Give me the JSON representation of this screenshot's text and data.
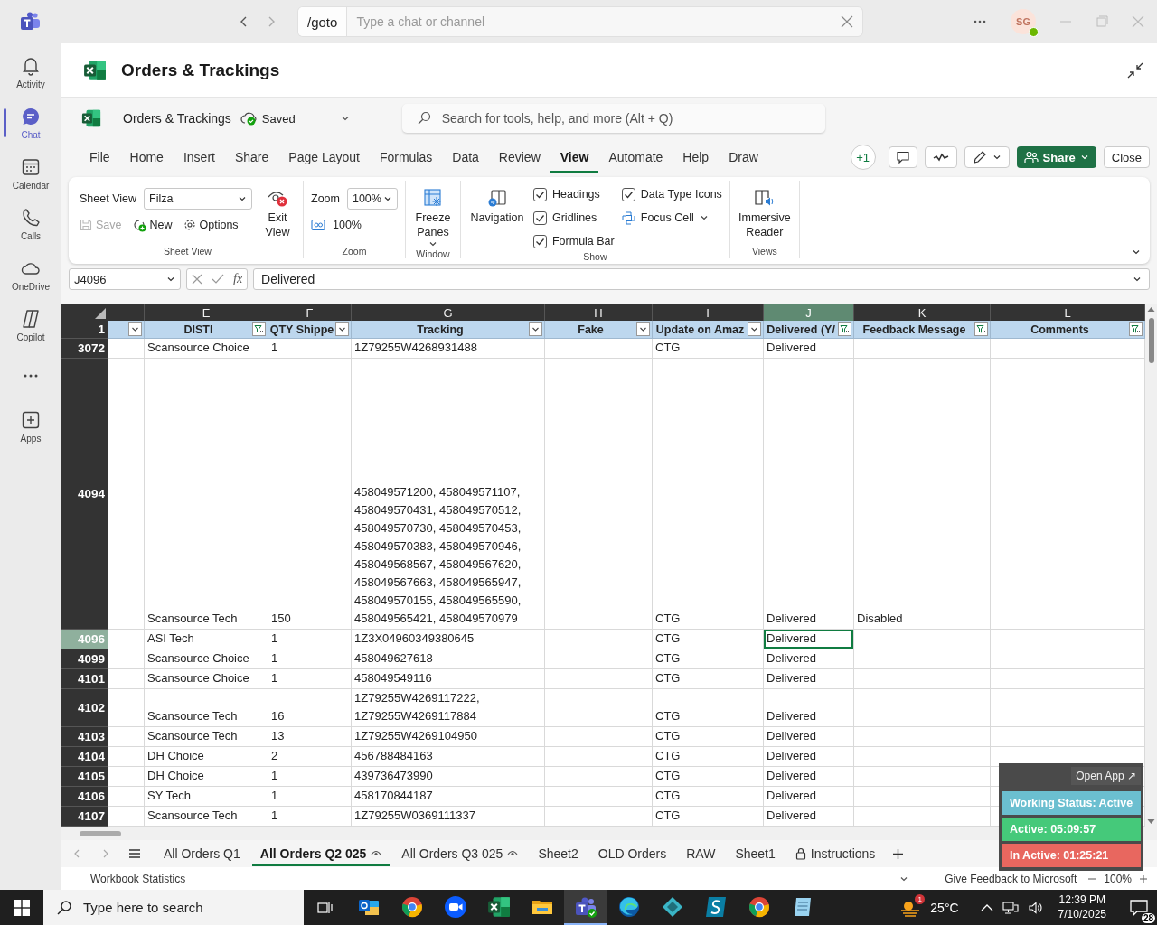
{
  "teams_bar": {
    "command": "/goto",
    "search_placeholder": "Type a chat or channel",
    "avatar_initials": "SG"
  },
  "rail": [
    {
      "kind": "bell",
      "label": "Activity",
      "selected": false
    },
    {
      "kind": "chat",
      "label": "Chat",
      "selected": true
    },
    {
      "kind": "calendar",
      "label": "Calendar",
      "selected": false
    },
    {
      "kind": "phone",
      "label": "Calls",
      "selected": false
    },
    {
      "kind": "cloud",
      "label": "OneDrive",
      "selected": false
    },
    {
      "kind": "copilot",
      "label": "Copilot",
      "selected": false
    },
    {
      "kind": "more",
      "selected": false
    },
    {
      "kind": "apps",
      "label": "Apps",
      "selected": false
    }
  ],
  "app_header": {
    "title": "Orders & Trackings"
  },
  "excel": {
    "file_name": "Orders & Trackings",
    "save_status": "Saved",
    "search_placeholder": "Search for tools, help, and more (Alt + Q)"
  },
  "menu_tabs": [
    {
      "label": "File",
      "selected": false
    },
    {
      "label": "Home",
      "selected": false
    },
    {
      "label": "Insert",
      "selected": false
    },
    {
      "label": "Share",
      "selected": false
    },
    {
      "label": "Page Layout",
      "selected": false
    },
    {
      "label": "Formulas",
      "selected": false
    },
    {
      "label": "Data",
      "selected": false
    },
    {
      "label": "Review",
      "selected": false
    },
    {
      "label": "View",
      "selected": true
    },
    {
      "label": "Automate",
      "selected": false
    },
    {
      "label": "Help",
      "selected": false
    },
    {
      "label": "Draw",
      "selected": false
    }
  ],
  "toolbar": {
    "coauthors": "+1",
    "share": "Share",
    "close": "Close"
  },
  "ribbon": {
    "sheet_view": {
      "label": "Sheet View",
      "select_label": "Sheet View",
      "select_value": "Filza",
      "save": "Save",
      "save_disabled": true,
      "new": "New",
      "options": "Options",
      "exit": "Exit View"
    },
    "zoom": {
      "label": "Zoom",
      "select_label": "Zoom",
      "select_value": "100%",
      "reset": "100%"
    },
    "window": {
      "label": "Window",
      "freeze": "Freeze Panes"
    },
    "show": {
      "label": "Show",
      "navigation": "Navigation",
      "checks": [
        {
          "label": "Headings",
          "checked": true
        },
        {
          "label": "Gridlines",
          "checked": true
        },
        {
          "label": "Formula Bar",
          "checked": true
        },
        {
          "label": "Data Type Icons",
          "checked": true
        }
      ],
      "focus_cell": "Focus Cell"
    },
    "views": {
      "label": "Views",
      "immersive": "Immersive Reader"
    }
  },
  "formula_bar": {
    "name_box": "J4096",
    "function_button": "fx",
    "formula": "Delivered"
  },
  "sheet": {
    "columns": [
      {
        "filtered": false,
        "selected": false
      },
      {
        "letter": "E",
        "title": "DISTI",
        "filtered": true,
        "selected": false
      },
      {
        "letter": "F",
        "title": "QTY Shippe",
        "filtered": false,
        "selected": false
      },
      {
        "letter": "G",
        "title": "Tracking",
        "filtered": false,
        "selected": false
      },
      {
        "letter": "H",
        "title": "Fake",
        "filtered": false,
        "selected": false
      },
      {
        "letter": "I",
        "title": "Update on Amaz",
        "filtered": false,
        "selected": false
      },
      {
        "letter": "J",
        "title": "Delivered (Y/",
        "filtered": true,
        "selected": true
      },
      {
        "letter": "K",
        "title": "Feedback Message",
        "filtered": true,
        "selected": false
      },
      {
        "letter": "L",
        "title": "Comments",
        "filtered": true,
        "selected": false
      }
    ],
    "header_row": "1",
    "rows": [
      {
        "number": "3072",
        "selected": false,
        "disti": "Scansource Choice",
        "qty_shipped": "1",
        "tracking": "1Z79255W4268931488",
        "update_on_amazon": "CTG",
        "delivered": "Delivered"
      },
      {
        "number": "4094",
        "selected": false,
        "disti": "Scansource Tech",
        "qty_shipped": "150",
        "tracking": "458049571200, 458049571107, 458049570431, 458049570512, 458049570730, 458049570453, 458049570383, 458049570946, 458049568567, 458049567620, 458049567663, 458049565947, 458049570155, 458049565590, 458049565421, 458049570979",
        "update_on_amazon": "CTG",
        "delivered": "Delivered",
        "feedback_message": "Disabled"
      },
      {
        "number": "4096",
        "selected": true,
        "disti": "ASI Tech",
        "qty_shipped": "1",
        "tracking": "1Z3X04960349380645",
        "update_on_amazon": "CTG",
        "delivered": "Delivered"
      },
      {
        "number": "4099",
        "selected": false,
        "disti": "Scansource Choice",
        "qty_shipped": "1",
        "tracking": "458049627618",
        "update_on_amazon": "CTG",
        "delivered": "Delivered"
      },
      {
        "number": "4101",
        "selected": false,
        "disti": "Scansource Choice",
        "qty_shipped": "1",
        "tracking": "458049549116",
        "update_on_amazon": "CTG",
        "delivered": "Delivered"
      },
      {
        "number": "4102",
        "selected": false,
        "disti": "Scansource Tech",
        "qty_shipped": "16",
        "tracking": "1Z79255W4269117222, 1Z79255W4269117884",
        "update_on_amazon": "CTG",
        "delivered": "Delivered"
      },
      {
        "number": "4103",
        "selected": false,
        "disti": "Scansource Tech",
        "qty_shipped": "13",
        "tracking": "1Z79255W4269104950",
        "update_on_amazon": "CTG",
        "delivered": "Delivered"
      },
      {
        "number": "4104",
        "selected": false,
        "disti": "DH Choice",
        "qty_shipped": "2",
        "tracking": "456788484163",
        "update_on_amazon": "CTG",
        "delivered": "Delivered"
      },
      {
        "number": "4105",
        "selected": false,
        "disti": "DH Choice",
        "qty_shipped": "1",
        "tracking": "439736473990",
        "update_on_amazon": "CTG",
        "delivered": "Delivered"
      },
      {
        "number": "4106",
        "selected": false,
        "disti": "SY Tech",
        "qty_shipped": "1",
        "tracking": "458170844187",
        "update_on_amazon": "CTG",
        "delivered": "Delivered"
      },
      {
        "number": "4107",
        "selected": false,
        "disti": "Scansource Tech",
        "qty_shipped": "1",
        "tracking": "1Z79255W0369111337",
        "update_on_amazon": "CTG",
        "delivered": "Delivered"
      }
    ]
  },
  "sheet_tabs": [
    {
      "label": "All Orders Q1",
      "kind": "plain",
      "selected": false
    },
    {
      "label": "All Orders Q2 025",
      "kind": "view-only",
      "selected": true
    },
    {
      "label": "All Orders Q3 025",
      "kind": "view-only",
      "selected": false
    },
    {
      "label": "Sheet2",
      "kind": "plain",
      "selected": false
    },
    {
      "label": "OLD Orders",
      "kind": "plain",
      "selected": false
    },
    {
      "label": "RAW",
      "kind": "plain",
      "selected": false
    },
    {
      "label": "Sheet1",
      "kind": "plain",
      "selected": false
    },
    {
      "label": "Instructions",
      "kind": "locked",
      "selected": false
    }
  ],
  "status_bar": {
    "left": "Workbook Statistics",
    "feedback": "Give Feedback to Microsoft",
    "zoom": "100%"
  },
  "widget": {
    "open_app": "Open App ↗",
    "status": "Working Status: Active",
    "active": "Active: 05:09:57",
    "inactive": "In Active: 01:25:21"
  },
  "taskbar": {
    "search_placeholder": "Type here to search",
    "apps": [
      {
        "kind": "mail",
        "active": false
      },
      {
        "kind": "browser",
        "active": false
      },
      {
        "kind": "video",
        "active": false
      },
      {
        "kind": "sheet",
        "active": false
      },
      {
        "kind": "folder",
        "active": false
      },
      {
        "kind": "teams",
        "active": true
      },
      {
        "kind": "edge",
        "active": false
      },
      {
        "kind": "diamond",
        "active": false
      },
      {
        "kind": "swirl",
        "active": false
      },
      {
        "kind": "browser",
        "active": false
      },
      {
        "kind": "notepad",
        "active": false
      }
    ],
    "weather_badge": "1",
    "temperature": "25°C",
    "time": "12:39 PM",
    "date": "7/10/2025",
    "notifications": "28"
  }
}
